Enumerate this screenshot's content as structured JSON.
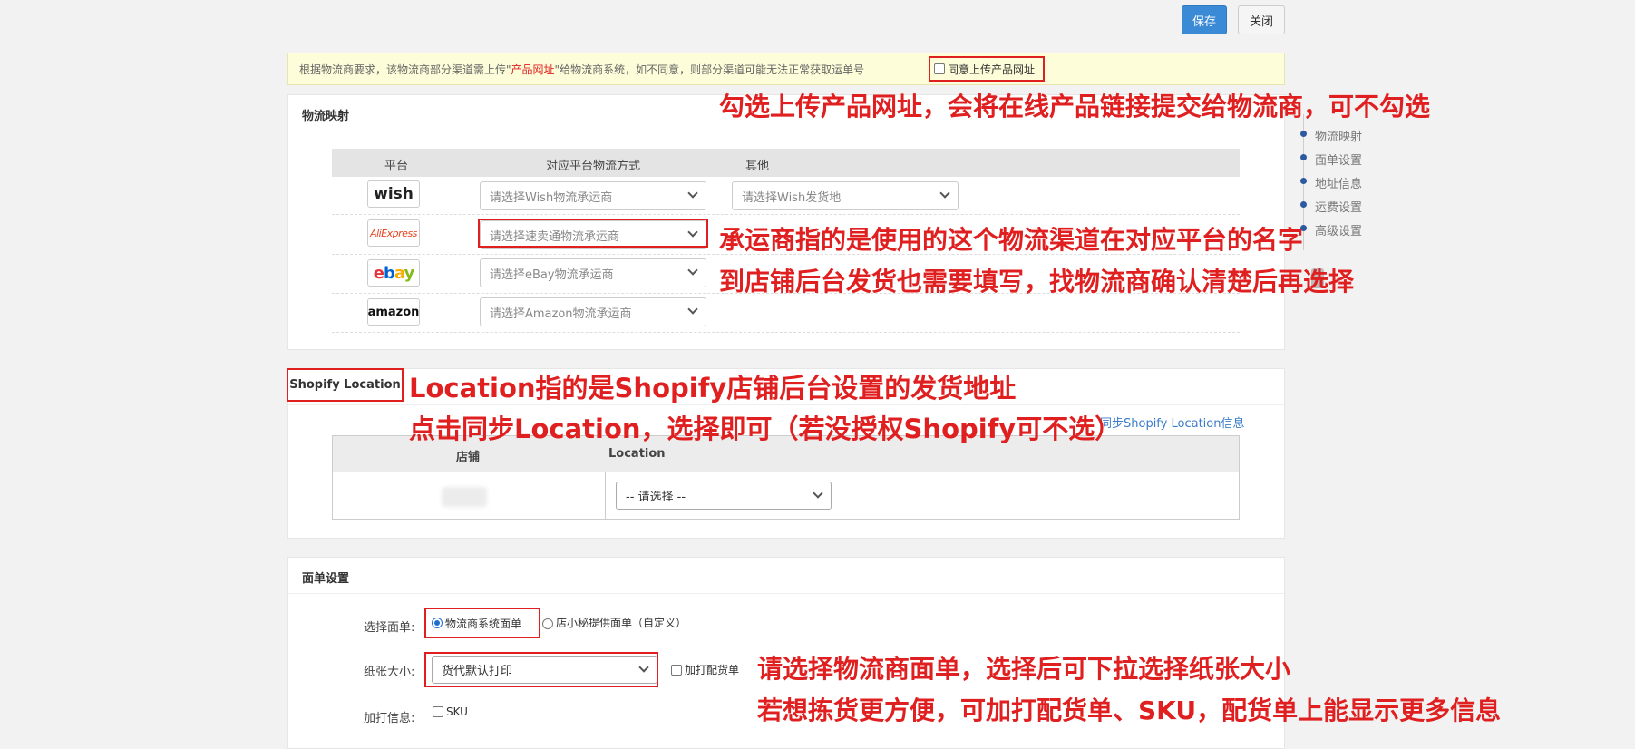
{
  "toolbar": {
    "save_label": "保存",
    "close_label": "关闭"
  },
  "notice": {
    "text_before": "根据物流商要求，该物流商部分渠道需上传\"",
    "highlight": "产品网址",
    "text_after": "\"给物流商系统，如不同意，则部分渠道可能无法正常获取运单号",
    "agree_label": "同意上传产品网址"
  },
  "mapping": {
    "title": "物流映射",
    "headers": {
      "platform": "平台",
      "method": "对应平台物流方式",
      "other": "其他"
    },
    "rows": [
      {
        "platform": "wish",
        "carrier_placeholder": "请选择Wish物流承运商",
        "other_placeholder": "请选择Wish发货地"
      },
      {
        "platform": "AliExpress",
        "carrier_placeholder": "请选择速卖通物流承运商"
      },
      {
        "platform": "ebay",
        "carrier_placeholder": "请选择eBay物流承运商"
      },
      {
        "platform": "amazon",
        "carrier_placeholder": "请选择Amazon物流承运商"
      }
    ]
  },
  "toc": {
    "items": [
      "物流映射",
      "面单设置",
      "地址信息",
      "运费设置",
      "高级设置"
    ]
  },
  "shopify": {
    "title": "Shopify Location",
    "sync_link": "同步Shopify Location信息",
    "headers": {
      "shop": "店铺",
      "location": "Location"
    },
    "location_select": "-- 请选择 --"
  },
  "label_settings": {
    "title": "面单设置",
    "select_label": "选择面单:",
    "option_carrier": "物流商系统面单",
    "option_custom": "店小秘提供面单（自定义）",
    "paper_label": "纸张大小:",
    "paper_value": "货代默认打印",
    "extra_pick_list": "加打配货单",
    "extra_label": "加打信息:",
    "sku_label": "SKU"
  },
  "annotations": {
    "a1": "勾选上传产品网址，会将在线产品链接提交给物流商，可不勾选",
    "a2": "承运商指的是使用的这个物流渠道在对应平台的名字",
    "a3": "到店铺后台发货也需要填写，找物流商确认清楚后再选择",
    "a4": "Location指的是Shopify店铺后台设置的发货地址",
    "a5": "点击同步Location，选择即可（若没授权Shopify可不选）",
    "a6": "请选择物流商面单，选择后可下拉选择纸张大小",
    "a7": "若想拣货更方便，可加打配货单、SKU，配货单上能显示更多信息"
  },
  "colors": {
    "accent": "#3a8ad6",
    "annotation": "#e02020",
    "toc_dot": "#2c5aa0"
  }
}
